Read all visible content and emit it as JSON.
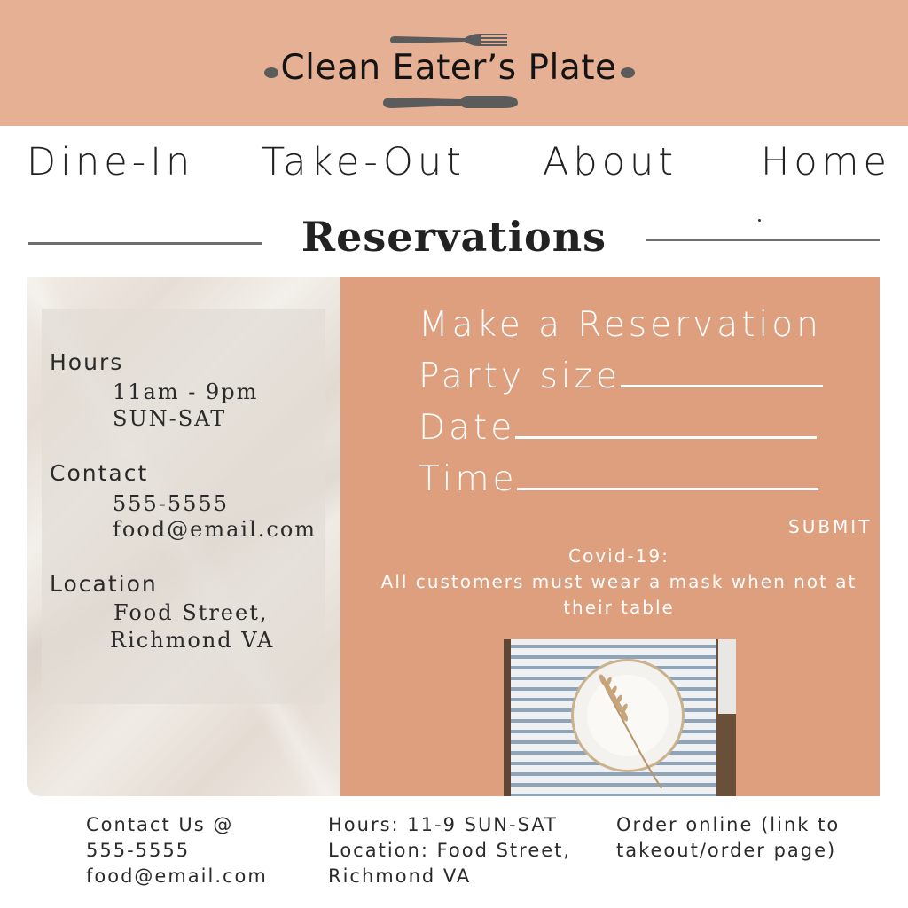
{
  "brand": {
    "name": "Clean Eater’s Plate"
  },
  "nav": {
    "items": [
      {
        "label": "Dine-In"
      },
      {
        "label": "Take-Out"
      },
      {
        "label": "About"
      },
      {
        "label": "Home"
      }
    ]
  },
  "page_title": "Reservations",
  "info": {
    "hours_label": "Hours",
    "hours_time": "11am - 9pm",
    "hours_days": "SUN-SAT",
    "contact_label": "Contact",
    "contact_phone": "555-5555",
    "contact_email": "food@email.com",
    "location_label": "Location",
    "location_street": "Food Street,",
    "location_city": "Richmond VA"
  },
  "form": {
    "title": "Make a Reservation",
    "party_label": "Party size",
    "date_label": "Date",
    "time_label": "Time",
    "submit_label": "SUBMIT"
  },
  "covid": {
    "title": "Covid-19:",
    "text": "All customers must wear a mask when not at their table"
  },
  "footer": {
    "contact_line1": "Contact Us @",
    "contact_line2": "555-5555",
    "contact_line3": "food@email.com",
    "hours_line1": "Hours: 11-9 SUN-SAT",
    "hours_line2": "Location: Food Street,",
    "hours_line3": "Richmond VA",
    "order_line1": "Order online (link to",
    "order_line2": "takeout/order page)"
  },
  "colors": {
    "header_bg": "#e6b094",
    "panel_bg": "#de9f7e",
    "text_dark": "#1e1e1e",
    "text_light": "#ffffff"
  }
}
